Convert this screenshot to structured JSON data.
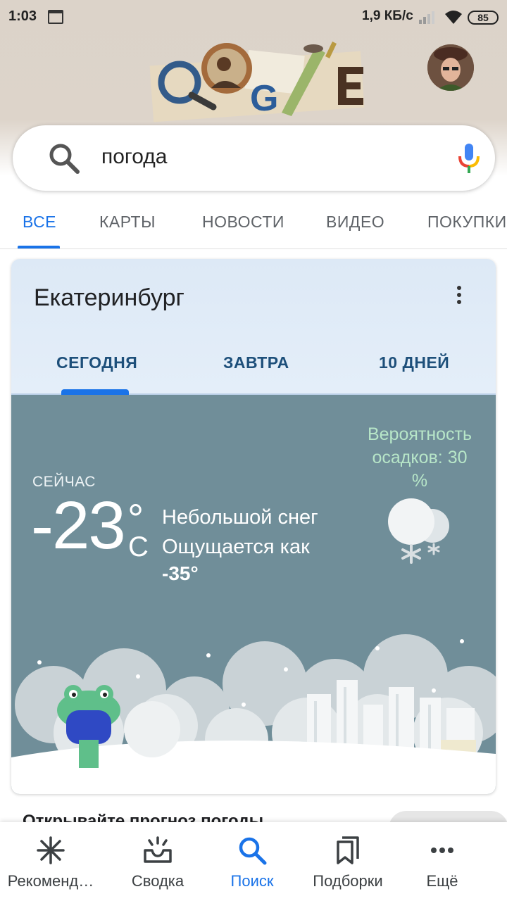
{
  "status_bar": {
    "time": "1:03",
    "speed": "1,9 КБ/с",
    "battery": "85",
    "icons": [
      "calendar-icon",
      "signal-icon",
      "wifi-icon",
      "battery-icon"
    ]
  },
  "search": {
    "query": "погода",
    "icons": [
      "search-icon",
      "mic-icon"
    ]
  },
  "tabs": [
    "ВСЕ",
    "КАРТЫ",
    "НОВОСТИ",
    "ВИДЕО",
    "ПОКУПКИ"
  ],
  "active_tab": "ВСЕ",
  "weather": {
    "city": "Екатеринбург",
    "tabs": [
      "СЕГОДНЯ",
      "ЗАВТРА",
      "10 ДНЕЙ"
    ],
    "now_label": "СЕЙЧАС",
    "temperature": "-23",
    "degree_symbol": "°",
    "unit": "C",
    "condition": "Небольшой снег",
    "feels_like_label": "Ощущается как",
    "feels_like_value": "-35°",
    "precip_line1": "Вероятность",
    "precip_line2": "осадков: 30",
    "precip_line3": "%",
    "condition_icon": "light-snow-icon"
  },
  "promo_text": "Открывайте прогноз погоды",
  "bottom_nav": [
    {
      "label": "Рекоменд…",
      "icon": "sparkle-icon"
    },
    {
      "label": "Сводка",
      "icon": "inbox-icon"
    },
    {
      "label": "Поиск",
      "icon": "search-icon"
    },
    {
      "label": "Подборки",
      "icon": "bookmarks-icon"
    },
    {
      "label": "Ещё",
      "icon": "more-horizontal-icon"
    }
  ],
  "colors": {
    "accent": "#1a73e8",
    "weather_bg": "#708e99",
    "precip_text": "#b7e6c8",
    "header_bg": "#ddd4ca"
  }
}
